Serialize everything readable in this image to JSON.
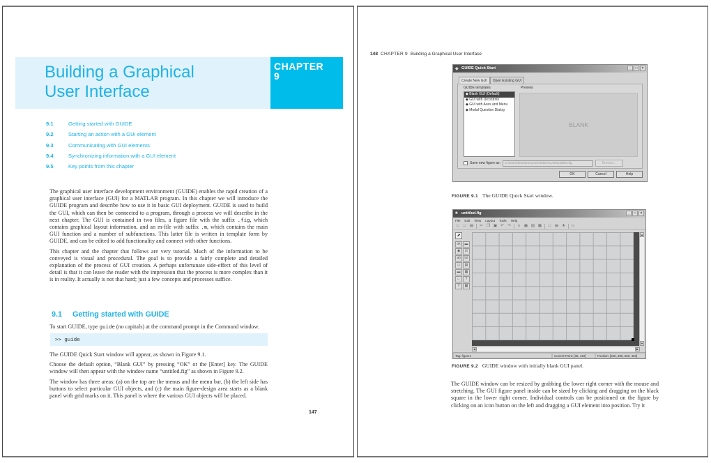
{
  "left_page": {
    "chapter_banner": {
      "title_line1": "Building a Graphical",
      "title_line2": "User Interface",
      "chapter_label": "CHAPTER",
      "chapter_number": "9"
    },
    "toc": [
      {
        "num": "9.1",
        "label": "Getting started with GUIDE"
      },
      {
        "num": "9.2",
        "label": "Starting an action with a GUI element"
      },
      {
        "num": "9.3",
        "label": "Communicating with GUI elements"
      },
      {
        "num": "9.4",
        "label": "Synchronizing information with a GUI element"
      },
      {
        "num": "9.5",
        "label": "Key points from this chapter"
      }
    ],
    "intro_p1": {
      "a": "The graphical user interface development environment (GUIDE) enables the rapid creation of a graphical user interface (GUI) for a MATLAB program. In this chapter we will introduce the GUIDE program and describe how to use it in basic GUI deployment. GUIDE is used to build the GUI, which can then be connected to a program, through a process we will describe in the next chapter. The GUI is contained in two files, a figure file with the suffix ",
      "code1": ".fig",
      "b": ", which contains graphical layout information, and an m-file with suffix ",
      "code2": ".m",
      "c": ", which contains the main GUI function and a number of subfunctions. This latter file is written in template form by GUIDE, and can be edited to add functionality and connect with other functions."
    },
    "intro_p2": "This chapter and the chapter that follows are very tutorial. Much of the information to be conveyed is visual and procedural. The goal is to provide a fairly complete and detailed explanation of the process of GUI creation. A perhaps unfortunate side-effect of this level of detail is that it can leave the reader with the impression that the process is more complex than it is in reality. It actually is not that hard; just a few concepts and processes suffice.",
    "section": {
      "num": "9.1",
      "title": "Getting started with GUIDE"
    },
    "section_p1": {
      "a": "To start GUIDE, type ",
      "code": "guide",
      "b": " (no capitals) at the command prompt in the Command window."
    },
    "code_block": ">> guide",
    "para_after_1": "The GUIDE Quick Start window will appear, as shown in Figure 9.1.",
    "para_after_2": "Choose the default option, “Blank GUI” by pressing “OK” or the [Enter] key. The GUIDE window will then appear with the window name “untitled.fig” as shown in Figure 9.2.",
    "para_after_3": "The window has three areas: (a) on the top are the menus and the menu bar, (b) the left side has buttons to select particular GUI objects, and (c) the main figure-design area starts as a blank panel with grid marks on it. This panel is where the various GUI objects will be placed.",
    "page_number": "147"
  },
  "right_page": {
    "running_head": {
      "page": "148",
      "chapter": "CHAPTER 9",
      "title": "Building a Graphical User Interface"
    },
    "figure1": {
      "window_title": "GUIDE Quick Start",
      "tabs": [
        "Create New GUI",
        "Open Existing GUI"
      ],
      "templates_label": "GUIDE templates",
      "templates": [
        "Blank GUI (Default)",
        "GUI with Uicontrols",
        "GUI with Axes and Menu",
        "Modal Question Dialog"
      ],
      "selected_template": "Blank GUI (Default)",
      "preview_label": "Preview",
      "preview_text": "BLANK",
      "save_label": "Save new figure as:",
      "save_path": "C:\\Users\\lent\\Documents\\MATLAB\\untitled.fig",
      "save_checked": false,
      "browse_label": "Browse...",
      "ok_label": "OK",
      "cancel_label": "Cancel",
      "help_label": "Help",
      "caption_label": "FIGURE 9.1",
      "caption_text": "The GUIDE Quick Start window."
    },
    "figure2": {
      "window_title": "untitled.fig",
      "menus": [
        "File",
        "Edit",
        "View",
        "Layout",
        "Tools",
        "Help"
      ],
      "status_tag": "Tag: figure1",
      "status_current_point": "Current Point:  [35, 410]",
      "status_position": "Position: [520, 380, 560, 420]",
      "caption_label": "FIGURE 9.2",
      "caption_text": "GUIDE window with initially blank GUI panel."
    },
    "body_p1": "The GUIDE window can be resized by grabbing the lower right corner with the mouse and stretching. The GUI figure panel inside can be sized by clicking and dragging on the black square in the lower right corner. Individual controls can be positioned on the figure by clicking on an icon button on the left and dragging a GUI element into position. Try it"
  }
}
